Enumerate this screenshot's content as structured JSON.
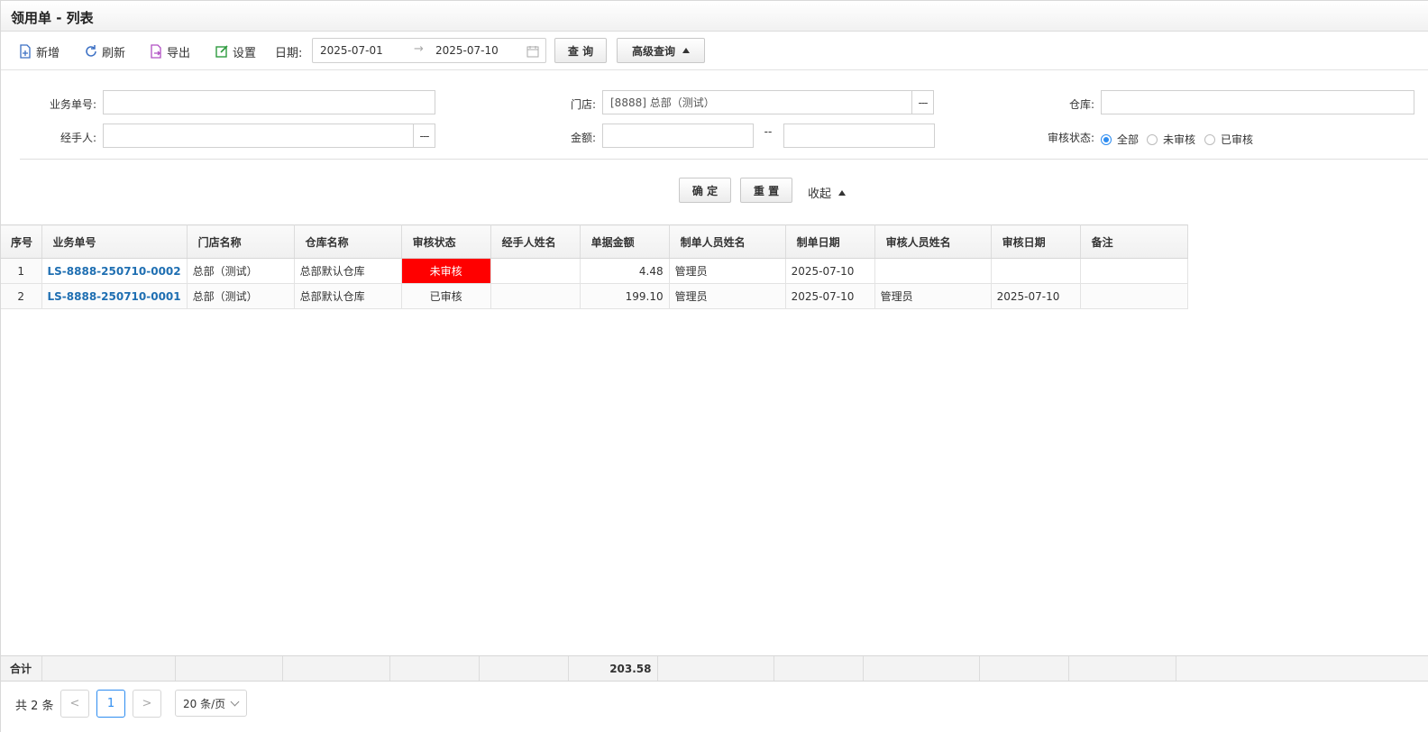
{
  "window": {
    "title": "领用单 - 列表"
  },
  "toolbar": {
    "add": "新增",
    "refresh": "刷新",
    "export": "导出",
    "settings": "设置",
    "date_label": "日期:",
    "date_from": "2025-07-01",
    "date_to": "2025-07-10",
    "date_arrow": "→",
    "query": "查 询",
    "advanced": "高级查询"
  },
  "filters": {
    "order_no_label": "业务单号:",
    "order_no_value": "",
    "store_label": "门店:",
    "store_value": "[8888] 总部（测试）",
    "warehouse_label": "仓库:",
    "warehouse_value": "",
    "handler_label": "经手人:",
    "handler_value": "",
    "amount_label": "金额:",
    "amount_from": "",
    "amount_sep": "--",
    "amount_to": "",
    "audit_label": "审核状态:",
    "audit_options": [
      "全部",
      "未审核",
      "已审核"
    ],
    "audit_selected": "全部",
    "dots": "---",
    "confirm": "确 定",
    "reset": "重 置",
    "collapse": "收起"
  },
  "table": {
    "columns": [
      "序号",
      "业务单号",
      "门店名称",
      "仓库名称",
      "审核状态",
      "经手人姓名",
      "单据金额",
      "制单人员姓名",
      "制单日期",
      "审核人员姓名",
      "审核日期",
      "备注"
    ],
    "rows": [
      [
        "1",
        "LS-8888-250710-0002",
        "总部（测试）",
        "总部默认仓库",
        "未审核",
        "",
        "4.48",
        "管理员",
        "2025-07-10",
        "",
        "",
        ""
      ],
      [
        "2",
        "LS-8888-250710-0001",
        "总部（测试）",
        "总部默认仓库",
        "已审核",
        "",
        "199.10",
        "管理员",
        "2025-07-10",
        "管理员",
        "2025-07-10",
        ""
      ]
    ],
    "summary_label": "合计",
    "summary_amount": "203.58"
  },
  "pager": {
    "total": "共 2 条",
    "prev": "<",
    "current": "1",
    "next": ">",
    "page_size": "20 条/页"
  },
  "colors": {
    "accent": "#2d8cf0",
    "link": "#1f6fb2",
    "unaudited": "#ff0000"
  }
}
